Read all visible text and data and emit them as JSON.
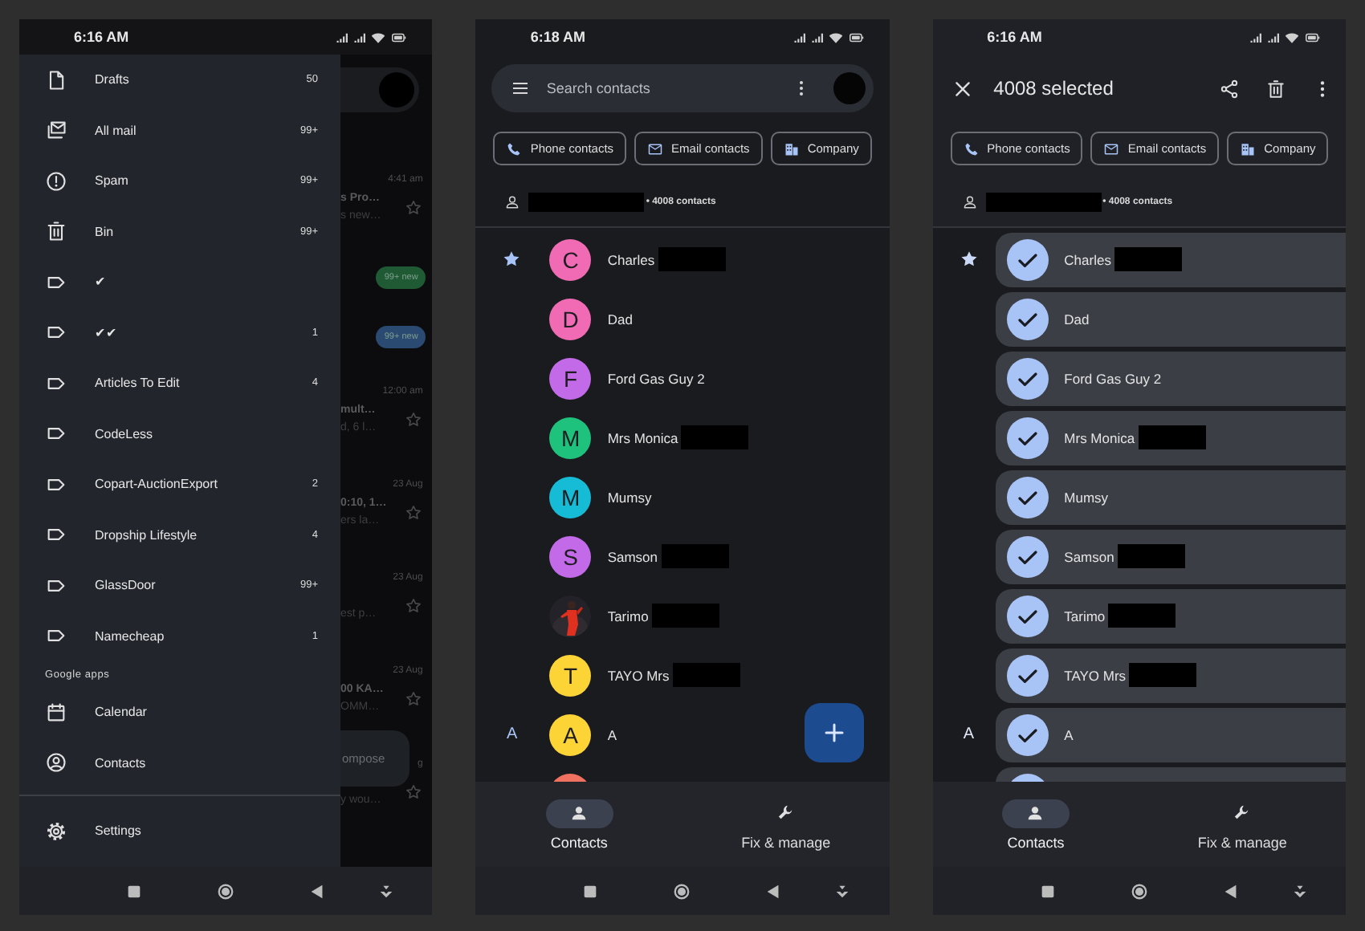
{
  "screens": [
    {
      "kind": "mail_drawer",
      "status_time": "6:16 AM",
      "drawer": {
        "items": [
          {
            "kind": "draft",
            "label": "Drafts",
            "count": "50"
          },
          {
            "kind": "all_mail",
            "label": "All mail",
            "count": "99+"
          },
          {
            "kind": "spam",
            "label": "Spam",
            "count": "99+"
          },
          {
            "kind": "bin",
            "label": "Bin",
            "count": "99+"
          },
          {
            "kind": "label",
            "label": "✔"
          },
          {
            "kind": "label",
            "label": "✔✔",
            "count": "1"
          },
          {
            "kind": "label",
            "label": "Articles To Edit",
            "count": "4"
          },
          {
            "kind": "label",
            "label": "CodeLess"
          },
          {
            "kind": "label",
            "label": "Copart-AuctionExport",
            "count": "2"
          },
          {
            "kind": "label",
            "label": "Dropship Lifestyle",
            "count": "4"
          },
          {
            "kind": "label",
            "label": "GlassDoor",
            "count": "99+"
          },
          {
            "kind": "label",
            "label": "Namecheap",
            "count": "1"
          }
        ],
        "section_title": "Google apps",
        "apps": [
          {
            "kind": "calendar",
            "label": "Calendar"
          },
          {
            "kind": "contacts",
            "label": "Contacts"
          }
        ],
        "footer": [
          {
            "kind": "settings",
            "label": "Settings"
          }
        ]
      },
      "background": {
        "messages": [
          {
            "kind": "mail",
            "time": "4:41 am",
            "subject": "s Pro…",
            "snippet": "s new…"
          },
          {
            "kind": "badge",
            "label": "99+ new",
            "color": "#1f5a34"
          },
          {
            "kind": "badge",
            "label": "99+ new",
            "color": "#2a4a72"
          },
          {
            "kind": "mail",
            "time": "12:00 am",
            "subject": "mult…",
            "snippet": "d, 6 l…"
          },
          {
            "kind": "mail",
            "time": "23 Aug",
            "subject": "0:10, 1…",
            "snippet": "ers la…"
          },
          {
            "kind": "mail",
            "time": "23 Aug",
            "snippet": "est p…"
          },
          {
            "kind": "mail",
            "time": "23 Aug",
            "subject": "00 KA…",
            "snippet": "OMM…"
          },
          {
            "kind": "mail",
            "time": "g",
            "snippet": "y wou…"
          }
        ],
        "compose": "ompose"
      }
    },
    {
      "kind": "contacts",
      "status_time": "6:18 AM",
      "search": {
        "placeholder": "Search contacts"
      },
      "chips": [
        {
          "kind": "phone",
          "label": "Phone contacts"
        },
        {
          "kind": "mail",
          "label": "Email contacts"
        },
        {
          "kind": "company",
          "label": "Company"
        }
      ],
      "account": {
        "redacted": true,
        "count": "• 4008 contacts"
      },
      "contacts": [
        {
          "kind": "letter",
          "name": "Charles",
          "initial": "C",
          "color": "#f06bb3",
          "starred": true,
          "redacted": true
        },
        {
          "kind": "letter",
          "name": "Dad",
          "initial": "D",
          "color": "#f06bb3",
          "starred": false,
          "redacted": false
        },
        {
          "kind": "letter",
          "name": "Ford Gas Guy 2",
          "initial": "F",
          "color": "#c26ae8",
          "starred": false,
          "redacted": false
        },
        {
          "kind": "letter",
          "name": "Mrs Monica",
          "initial": "M",
          "color": "#1fc27c",
          "starred": false,
          "redacted": true
        },
        {
          "kind": "letter",
          "name": "Mumsy",
          "initial": "M",
          "color": "#16bcd6",
          "starred": false,
          "redacted": false
        },
        {
          "kind": "letter",
          "name": "Samson",
          "initial": "S",
          "color": "#c26ae8",
          "starred": false,
          "redacted": true
        },
        {
          "kind": "picture",
          "name": "Tarimo",
          "starred": false,
          "redacted": true
        },
        {
          "kind": "letter",
          "name": "TAYO Mrs",
          "initial": "T",
          "color": "#fdd436",
          "starred": false,
          "redacted": true
        },
        {
          "kind": "letter",
          "name": "A",
          "initial": "A",
          "color": "#fdd436",
          "starred": false,
          "redacted": false,
          "section": "A"
        },
        {
          "kind": "letter",
          "color": "#f0715f",
          "starred": false,
          "redacted": false
        }
      ],
      "fab": {
        "kind": "add"
      },
      "bottom_nav": [
        {
          "kind": "person",
          "label": "Contacts",
          "selected": true
        },
        {
          "kind": "wrench",
          "label": "Fix & manage",
          "selected": false
        }
      ]
    },
    {
      "kind": "contacts_selection",
      "status_time": "6:16 AM",
      "selection": {
        "title": "4008 selected"
      },
      "chips": [
        {
          "kind": "phone",
          "label": "Phone contacts"
        },
        {
          "kind": "mail",
          "label": "Email contacts"
        },
        {
          "kind": "company",
          "label": "Company"
        }
      ],
      "account": {
        "redacted": true,
        "count": "• 4008 contacts"
      },
      "contacts": [
        {
          "name": "Charles",
          "starred": true,
          "redacted": true,
          "selected": true
        },
        {
          "name": "Dad",
          "starred": false,
          "redacted": false,
          "selected": true
        },
        {
          "name": "Ford Gas Guy 2",
          "starred": false,
          "redacted": false,
          "selected": true
        },
        {
          "name": "Mrs Monica",
          "starred": false,
          "redacted": true,
          "selected": true
        },
        {
          "name": "Mumsy",
          "starred": false,
          "redacted": false,
          "selected": true
        },
        {
          "name": "Samson",
          "starred": false,
          "redacted": true,
          "selected": true
        },
        {
          "name": "Tarimo",
          "starred": false,
          "redacted": true,
          "selected": true
        },
        {
          "name": "TAYO Mrs",
          "starred": false,
          "redacted": true,
          "selected": true
        },
        {
          "name": "A",
          "starred": false,
          "redacted": false,
          "selected": true,
          "section": "A"
        },
        {
          "starred": false,
          "redacted": false,
          "selected": true
        }
      ],
      "bottom_nav": [
        {
          "kind": "person",
          "label": "Contacts",
          "selected": true
        },
        {
          "kind": "wrench",
          "label": "Fix & manage",
          "selected": false
        }
      ]
    }
  ]
}
